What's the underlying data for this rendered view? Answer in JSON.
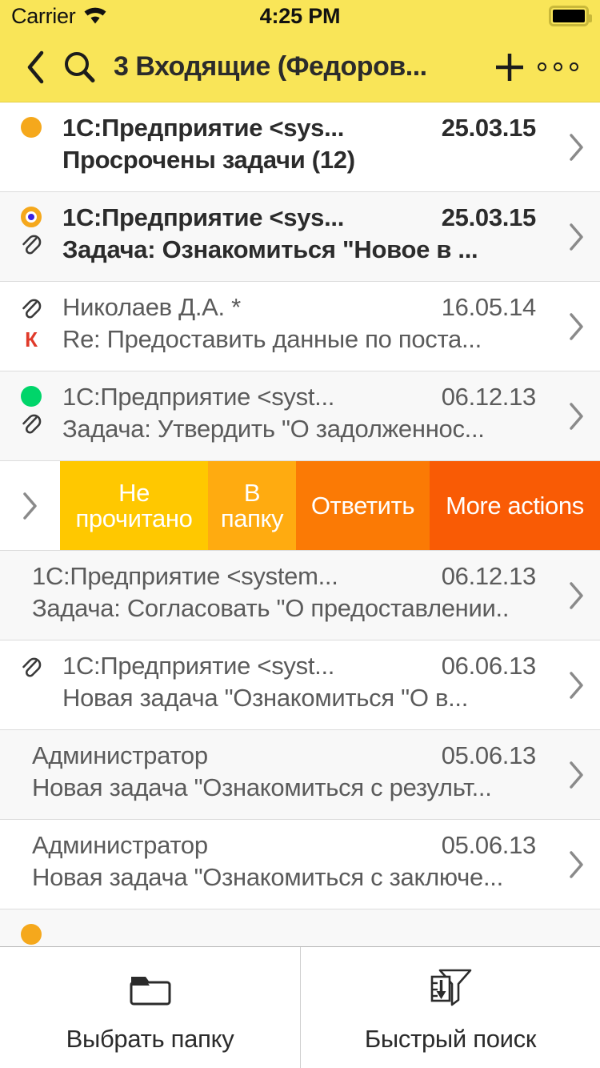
{
  "status_bar": {
    "carrier": "Carrier",
    "wifi_icon": "wifi-icon",
    "time": "4:25 PM",
    "battery_icon": "battery-full-icon"
  },
  "nav_bar": {
    "back_icon": "chevron-left-icon",
    "search_icon": "search-icon",
    "title": "3 Входящие (Федоров...",
    "add_icon": "plus-icon",
    "more_icon": "more-horizontal-icon",
    "background_color": "#f9e558"
  },
  "messages": [
    {
      "marker": "orange-dot",
      "attachment": false,
      "flag": "",
      "from": "1С:Предприятие <sys...",
      "date": "25.03.15",
      "subject": "Просрочены задачи (12)",
      "unread": true,
      "alt_background": false
    },
    {
      "marker": "orange-ring-blue-dot",
      "attachment": true,
      "flag": "",
      "from": "1С:Предприятие <sys...",
      "date": "25.03.15",
      "subject": "Задача: Ознакомиться \"Новое в ...",
      "unread": true,
      "alt_background": true
    },
    {
      "marker": "none",
      "attachment": true,
      "flag": "К",
      "from": "Николаев Д.А. *",
      "date": "16.05.14",
      "subject": "Re: Предоставить данные по поста...",
      "unread": false,
      "alt_background": false
    },
    {
      "marker": "green-dot",
      "attachment": true,
      "flag": "",
      "from": "1С:Предприятие <syst...",
      "date": "06.12.13",
      "subject": "Задача: Утвердить \"О задолженнос...",
      "unread": false,
      "alt_background": true
    }
  ],
  "swipe_actions": {
    "peek_icon": "chevron-right-icon",
    "buttons": [
      {
        "label": "Не прочитано",
        "color": "#ffc800"
      },
      {
        "label": "В папку",
        "color": "#ffab10"
      },
      {
        "label": "Ответить",
        "color": "#fb7a05"
      },
      {
        "label": "More actions",
        "color": "#f95b05"
      }
    ]
  },
  "messages_after_swipe": [
    {
      "marker": "none",
      "attachment": false,
      "flag": "",
      "from": "1С:Предприятие <system...",
      "date": "06.12.13",
      "subject": "Задача: Согласовать \"О предоставлении..",
      "unread": false,
      "alt_background": true
    },
    {
      "marker": "none",
      "attachment": true,
      "flag": "",
      "from": "1С:Предприятие <syst...",
      "date": "06.06.13",
      "subject": "Новая задача \"Ознакомиться \"О в...",
      "unread": false,
      "alt_background": false
    },
    {
      "marker": "none",
      "attachment": false,
      "flag": "",
      "from": "Администратор",
      "date": "05.06.13",
      "subject": "Новая задача \"Ознакомиться с результ...",
      "unread": false,
      "alt_background": true
    },
    {
      "marker": "none",
      "attachment": false,
      "flag": "",
      "from": "Администратор",
      "date": "05.06.13",
      "subject": "Новая задача \"Ознакомиться с заключе...",
      "unread": false,
      "alt_background": false
    }
  ],
  "partial_row": {
    "marker": "orange-dot",
    "alt_background": true
  },
  "tab_bar": {
    "tabs": [
      {
        "label": "Выбрать папку",
        "icon": "folder-icon"
      },
      {
        "label": "Быстрый поиск",
        "icon": "filter-funnel-icon"
      }
    ]
  }
}
